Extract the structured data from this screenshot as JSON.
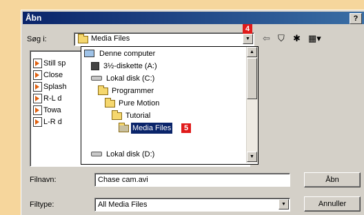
{
  "dialog": {
    "title": "Åbn",
    "help_label": "?"
  },
  "toolbar": {
    "lookin_label": "Søg i:",
    "lookin_value": "Media Files",
    "badge_lookin": "4"
  },
  "files": [
    {
      "label": "Still sp"
    },
    {
      "label": "Close"
    },
    {
      "label": "Splash"
    },
    {
      "label": "R-L d"
    },
    {
      "label": "Towa"
    },
    {
      "label": "L-R d"
    }
  ],
  "dropdown": {
    "items": [
      {
        "label": "Denne computer",
        "icon": "computer-icon"
      },
      {
        "label": "3½-diskette (A:)",
        "icon": "floppy-icon"
      },
      {
        "label": "Lokal disk (C:)",
        "icon": "disk-icon"
      },
      {
        "label": "Programmer",
        "icon": "folder-icon"
      },
      {
        "label": "Pure Motion",
        "icon": "folder-icon"
      },
      {
        "label": "Tutorial",
        "icon": "folder-icon"
      },
      {
        "label": "Media Files",
        "icon": "open-folder-icon",
        "selected": true
      },
      {
        "label": "Lokal disk (D:)",
        "icon": "disk-icon"
      }
    ],
    "badge_selected": "5"
  },
  "bottom": {
    "filename_label": "Filnavn:",
    "filename_value": "Chase cam.avi",
    "filetype_label": "Filtype:",
    "filetype_value": "All Media Files",
    "open_button": "Åbn",
    "cancel_button": "Annuller"
  },
  "colors": {
    "badge": "#e01a1a",
    "selection": "#0a246a",
    "background": "#f6d69c"
  }
}
